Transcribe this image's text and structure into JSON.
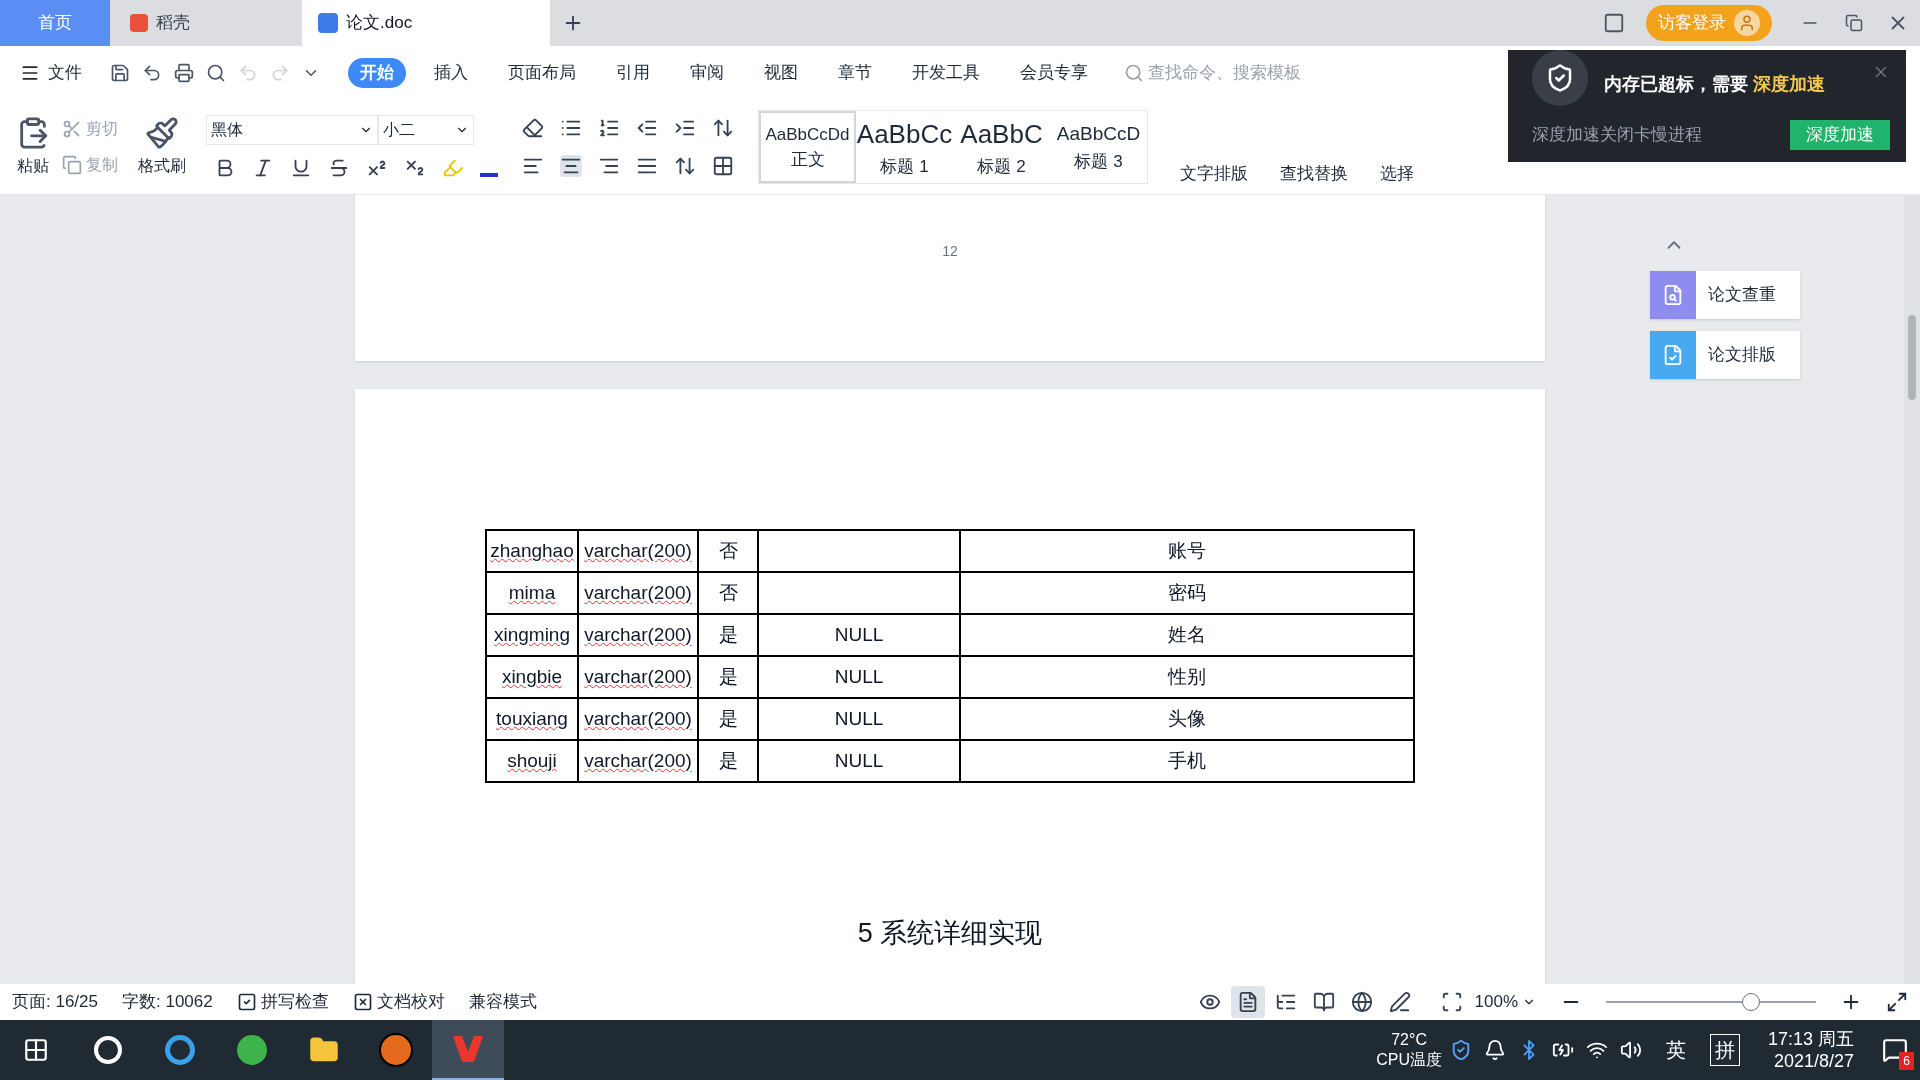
{
  "tabs": [
    {
      "kind": "home",
      "label": "首页",
      "selected": false
    },
    {
      "kind": "docer",
      "label": "稻壳",
      "selected": false
    },
    {
      "kind": "doc",
      "label": "论文.doc",
      "selected": true
    }
  ],
  "login": "访客登录",
  "menu": {
    "file": "文件",
    "ribbon_tabs": [
      {
        "label": "开始",
        "selected": true
      },
      {
        "label": "插入",
        "selected": false
      },
      {
        "label": "页面布局",
        "selected": false
      },
      {
        "label": "引用",
        "selected": false
      },
      {
        "label": "审阅",
        "selected": false
      },
      {
        "label": "视图",
        "selected": false
      },
      {
        "label": "章节",
        "selected": false
      },
      {
        "label": "开发工具",
        "selected": false
      },
      {
        "label": "会员专享",
        "selected": false
      }
    ],
    "search": {
      "placeholder": "查找命令、搜索模板"
    }
  },
  "ribbon": {
    "paste": "粘贴",
    "cut": {
      "label": "剪切",
      "disabled": true
    },
    "copy": {
      "label": "复制",
      "disabled": true
    },
    "format_painter": "格式刷",
    "font": "黑体",
    "font_size": "小二",
    "styles": [
      {
        "preview": "AaBbCcDd",
        "label": "正文",
        "selected": true
      },
      {
        "preview": "AaBbCc",
        "label": "标题 1",
        "selected": false
      },
      {
        "preview": "AaBbC",
        "label": "标题 2",
        "selected": false
      },
      {
        "preview": "AaBbCcD",
        "label": "标题 3",
        "selected": false
      }
    ],
    "extra_tools": [
      "文字排版",
      "查找替换",
      "选择"
    ]
  },
  "popup": {
    "message": "内存已超标，需要",
    "highlight": "深度加速",
    "subtext": "深度加速关闭卡慢进程",
    "button": "深度加速"
  },
  "document": {
    "page_number": "12",
    "table": {
      "rows": [
        [
          "zhanghao",
          "varchar(200)",
          "否",
          "",
          "账号"
        ],
        [
          "mima",
          "varchar(200)",
          "否",
          "",
          "密码"
        ],
        [
          "xingming",
          "varchar(200)",
          "是",
          "NULL",
          "姓名"
        ],
        [
          "xingbie",
          "varchar(200)",
          "是",
          "NULL",
          "性别"
        ],
        [
          "touxiang",
          "varchar(200)",
          "是",
          "NULL",
          "头像"
        ],
        [
          "shouji",
          "varchar(200)",
          "是",
          "NULL",
          "手机"
        ]
      ]
    },
    "heading": "5 系统详细实现"
  },
  "side_panel": [
    "论文查重",
    "论文排版"
  ],
  "status_bar": {
    "page": "页面: 16/25",
    "words": "字数: 10062",
    "spell_check": "拼写检查",
    "proofread": "文档校对",
    "mode": "兼容模式",
    "view_modes": [
      {
        "kind": "eye",
        "selected": false
      },
      {
        "kind": "page",
        "selected": true
      },
      {
        "kind": "outline",
        "selected": false
      },
      {
        "kind": "read",
        "selected": false
      },
      {
        "kind": "web",
        "selected": false
      },
      {
        "kind": "pen",
        "selected": false
      }
    ],
    "zoom": "100%",
    "zoom_slider": {
      "level": 0.69
    }
  },
  "taskbar": {
    "apps": [
      {
        "kind": "windows",
        "selected": false
      },
      {
        "kind": "pinwheel",
        "selected": false
      },
      {
        "kind": "ie",
        "selected": false
      },
      {
        "kind": "browser",
        "selected": false
      },
      {
        "kind": "folder",
        "selected": false
      },
      {
        "kind": "cat",
        "selected": false
      },
      {
        "kind": "wps",
        "selected": true
      }
    ],
    "temperature": "72°C",
    "temperature_label": "CPU温度",
    "ime": "英",
    "ime_mode": "拼",
    "time": "17:13 周五",
    "date": "2021/8/27",
    "notifications": "6"
  }
}
